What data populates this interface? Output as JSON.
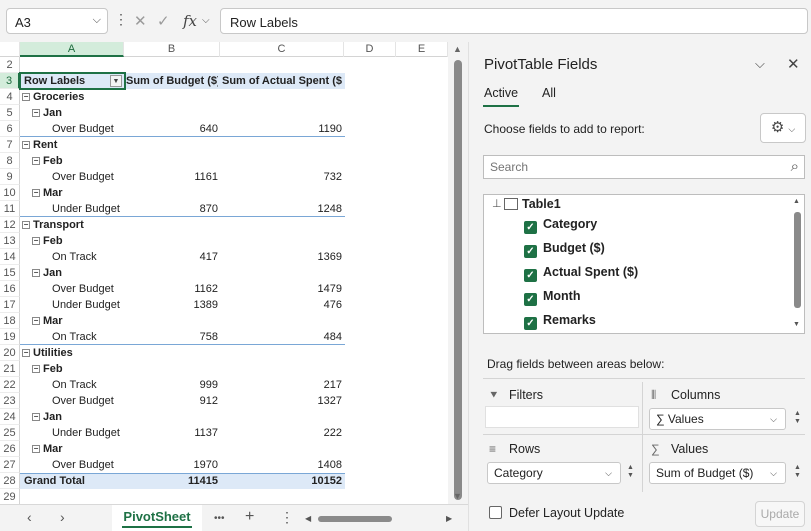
{
  "formula_bar": {
    "name_box": "A3",
    "cancel_icon": "✕",
    "enter_icon": "✓",
    "fx_label": "fx",
    "formula": "Row Labels"
  },
  "columns": [
    "A",
    "B",
    "C",
    "D",
    "E"
  ],
  "pivot": {
    "header": {
      "labels": "Row Labels",
      "budget": "Sum of Budget ($)",
      "actual": "Sum of Actual Spent ($)"
    },
    "groups": [
      {
        "name": "Groceries",
        "months": [
          {
            "name": "Jan",
            "rows": [
              {
                "label": "Over Budget",
                "budget": "640",
                "actual": "1190"
              }
            ]
          }
        ]
      },
      {
        "name": "Rent",
        "months": [
          {
            "name": "Feb",
            "rows": [
              {
                "label": "Over Budget",
                "budget": "1161",
                "actual": "732"
              }
            ]
          },
          {
            "name": "Mar",
            "rows": [
              {
                "label": "Under Budget",
                "budget": "870",
                "actual": "1248"
              }
            ]
          }
        ]
      },
      {
        "name": "Transport",
        "months": [
          {
            "name": "Feb",
            "rows": [
              {
                "label": "On Track",
                "budget": "417",
                "actual": "1369"
              }
            ]
          },
          {
            "name": "Jan",
            "rows": [
              {
                "label": "Over Budget",
                "budget": "1162",
                "actual": "1479"
              },
              {
                "label": "Under Budget",
                "budget": "1389",
                "actual": "476"
              }
            ]
          },
          {
            "name": "Mar",
            "rows": [
              {
                "label": "On Track",
                "budget": "758",
                "actual": "484"
              }
            ]
          }
        ]
      },
      {
        "name": "Utilities",
        "months": [
          {
            "name": "Feb",
            "rows": [
              {
                "label": "On Track",
                "budget": "999",
                "actual": "217"
              },
              {
                "label": "Over Budget",
                "budget": "912",
                "actual": "1327"
              }
            ]
          },
          {
            "name": "Jan",
            "rows": [
              {
                "label": "Under Budget",
                "budget": "1137",
                "actual": "222"
              }
            ]
          },
          {
            "name": "Mar",
            "rows": [
              {
                "label": "Over Budget",
                "budget": "1970",
                "actual": "1408"
              }
            ]
          }
        ]
      }
    ],
    "grand_total": {
      "label": "Grand Total",
      "budget": "11415",
      "actual": "10152"
    }
  },
  "row_numbers": [
    "2",
    "3",
    "4",
    "5",
    "6",
    "7",
    "8",
    "9",
    "10",
    "11",
    "12",
    "13",
    "14",
    "15",
    "16",
    "17",
    "18",
    "19",
    "20",
    "21",
    "22",
    "23",
    "24",
    "25",
    "26",
    "27",
    "28",
    "29"
  ],
  "sheet_tabs": {
    "active": "PivotSheet",
    "more": "•••",
    "add": "+"
  },
  "pane": {
    "title": "PivotTable Fields",
    "tabs": [
      "Active",
      "All"
    ],
    "choose_label": "Choose fields to add to report:",
    "search_placeholder": "Search",
    "table_name": "Table1",
    "fields": [
      "Category",
      "Budget ($)",
      "Actual Spent ($)",
      "Month",
      "Remarks"
    ],
    "drag_label": "Drag fields between areas below:",
    "areas": {
      "filters": "Filters",
      "columns": "Columns",
      "rows": "Rows",
      "values": "Values",
      "columns_item": "Values",
      "rows_item": "Category",
      "values_item": "Sum of Budget ($)"
    },
    "defer_label": "Defer Layout Update",
    "update_label": "Update"
  },
  "colors": {
    "accent": "#1e7145",
    "pivot_header": "#dde9f7",
    "group_line": "#7aa7d6"
  }
}
